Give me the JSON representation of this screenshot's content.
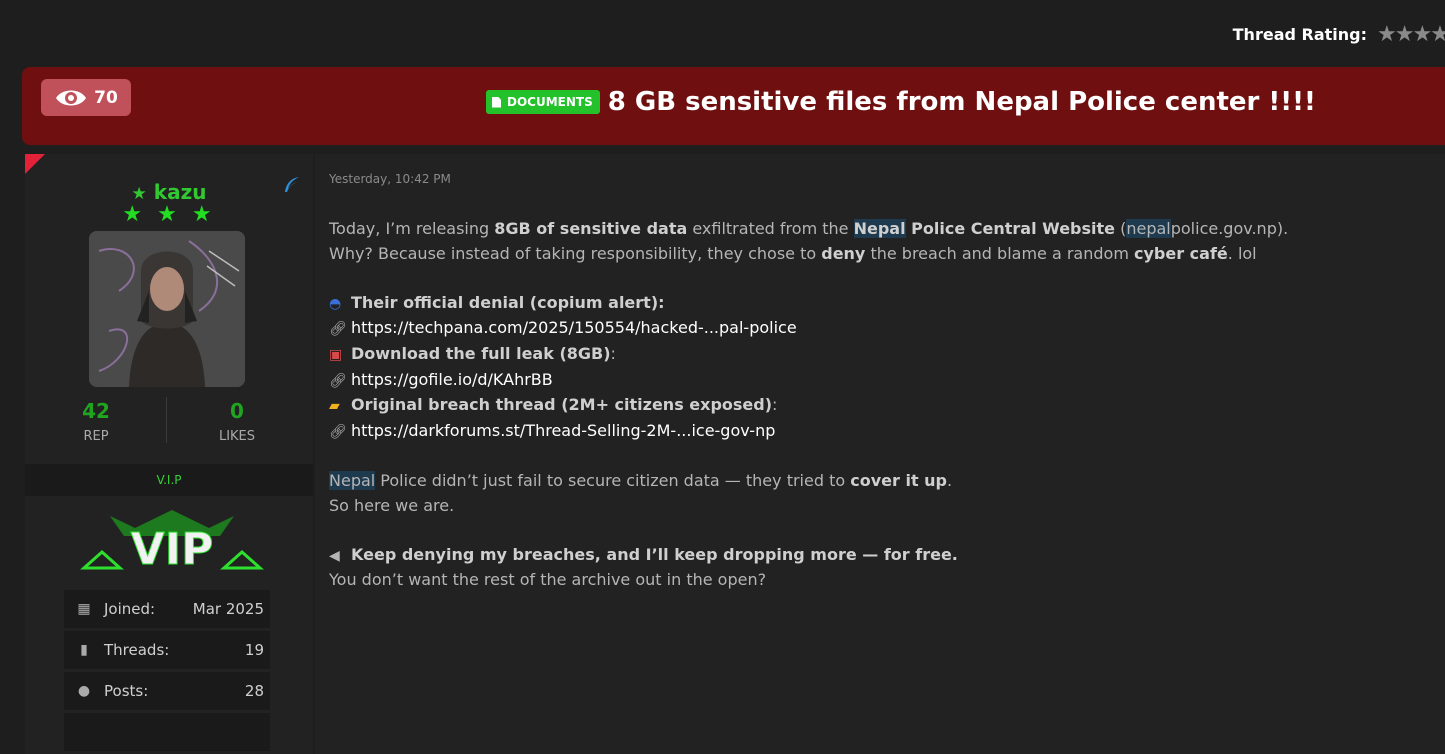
{
  "rating": {
    "label": "Thread Rating:",
    "value": 0,
    "max": 5
  },
  "thread": {
    "views": "70",
    "badge": "DOCUMENTS",
    "title": "8 GB sensitive files from Nepal Police center !!!!"
  },
  "user": {
    "name": "kazu",
    "rank_stars": "★ ★ ★",
    "rep_value": "42",
    "rep_label": "REP",
    "likes_value": "0",
    "likes_label": "LIKES",
    "group": "V.I.P",
    "vip_logo_text": "VIP",
    "info": [
      {
        "label": "Joined:",
        "value": "Mar 2025",
        "icon": "calendar-icon"
      },
      {
        "label": "Threads:",
        "value": "19",
        "icon": "book-icon"
      },
      {
        "label": "Posts:",
        "value": "28",
        "icon": "comments-icon"
      }
    ]
  },
  "post": {
    "date": "Yesterday, 10:42 PM",
    "p1": {
      "a": "Today, I’m releasing ",
      "b": "8GB of sensitive data",
      "c": " exfiltrated from the ",
      "d": "Nepal",
      "e": " Police Central Website",
      "f": " (",
      "g": "nepal",
      "h": "police.gov.np)."
    },
    "p2": {
      "a": "Why? Because instead of taking responsibility, they chose to ",
      "b": "deny",
      "c": " the breach and blame a random ",
      "d": "cyber café",
      "e": ". lol"
    },
    "denial_heading": "Their official denial (copium alert):",
    "link1": "https://techpana.com/2025/150554/hacked-...pal-police",
    "download_heading": "Download the full leak (8GB)",
    "download_colon": ":",
    "link2": "https://gofile.io/d/KAhrBB",
    "breach_heading": "Original breach thread (2M+ citizens exposed)",
    "breach_colon": ":",
    "link3": "https://darkforums.st/Thread-Selling-2M-...ice-gov-np",
    "p3": {
      "a": "Nepal",
      "b": " Police didn’t just fail to secure citizen data — they tried to ",
      "c": "cover it up",
      "d": "."
    },
    "p4": "So here we are.",
    "closing_heading": "Keep denying my breaches, and I’ll keep dropping more — for free.",
    "closing_line": "You don’t want the rest of the archive out in the open?"
  }
}
